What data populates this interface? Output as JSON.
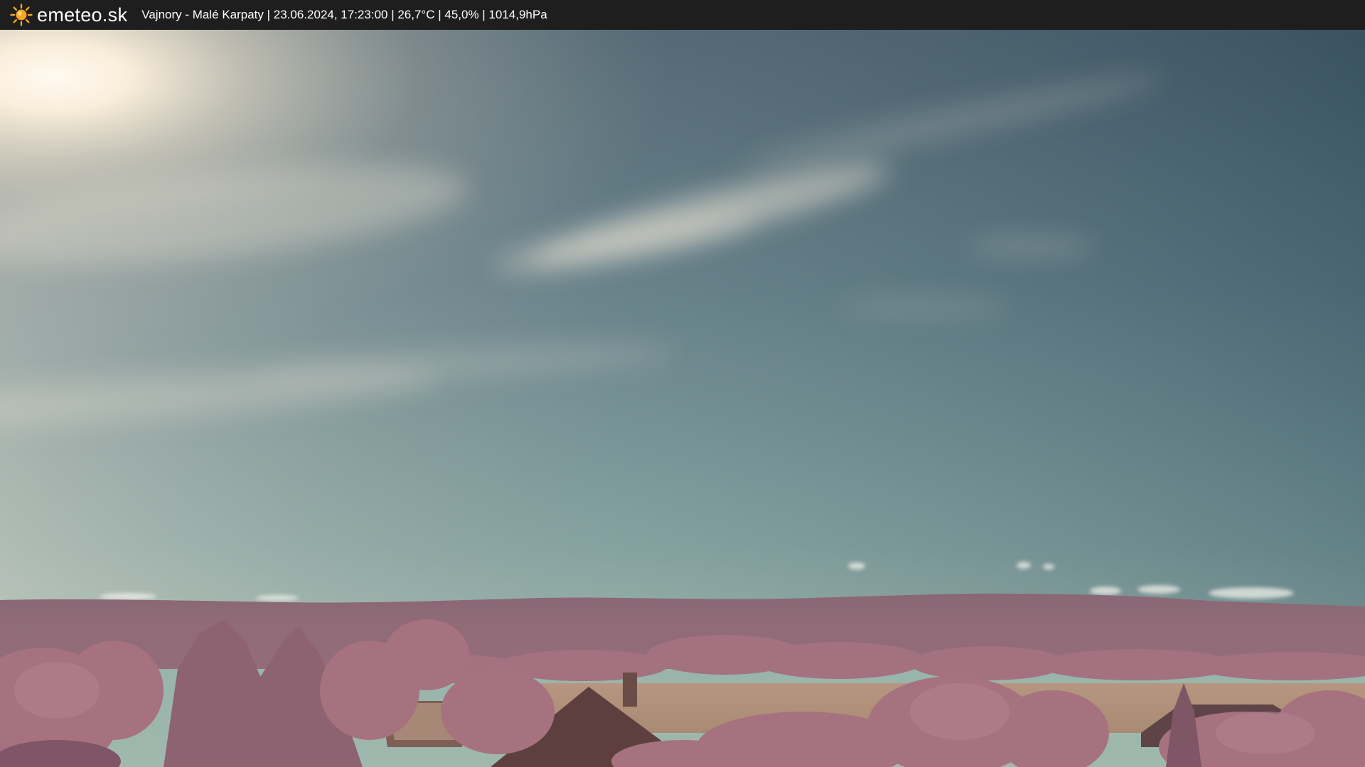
{
  "header": {
    "brand": "emeteo.sk",
    "caption": "Vajnory - Malé Karpaty | 23.06.2024, 17:23:00 | 26,7°C | 45,0% | 1014,9hPa",
    "logo_icon": "sun-icon"
  },
  "colors": {
    "bar_background": "#1e1e1e",
    "logo_sun": "#f5a623",
    "sky_top": "#3f5a6c",
    "sky_horizon": "#93b1a9",
    "foliage": "#a8727f"
  }
}
